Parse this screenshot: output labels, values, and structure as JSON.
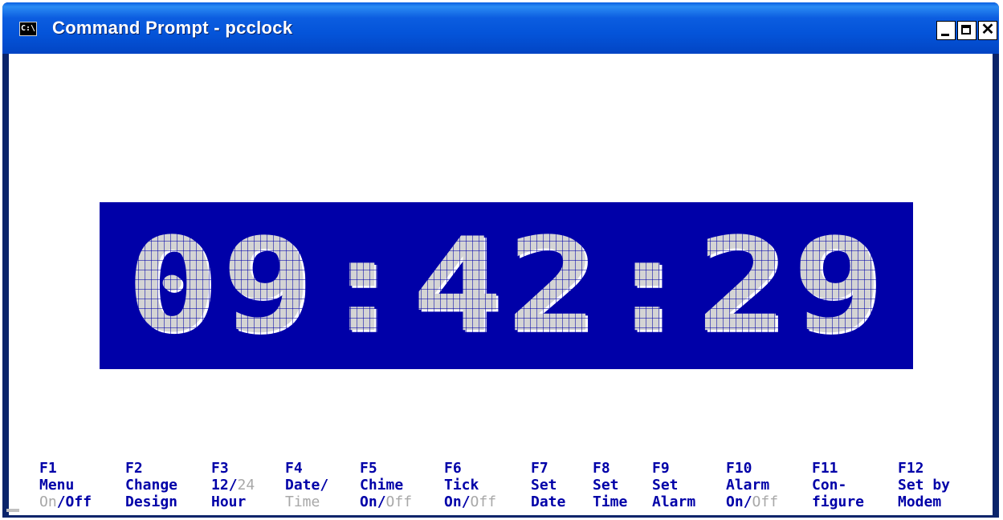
{
  "window": {
    "title": "Command Prompt - pcclock",
    "icon_text": "C:\\",
    "close_glyph": "✕"
  },
  "clock": {
    "time": "09:42:29",
    "digit_color": "#d4d4d4",
    "background_color": "#0000a8"
  },
  "fkeys": [
    {
      "key": "F1",
      "line2": "Menu",
      "line3_a": "On",
      "line3_sep": "/",
      "line3_b": "Off"
    },
    {
      "key": "F2",
      "line2": "Change",
      "line3_a": "",
      "line3_sep": "",
      "line3_b": "Design"
    },
    {
      "key": "F3",
      "line2_a": "12",
      "line2_sep": "/",
      "line2_b": "24",
      "line3": "Hour"
    },
    {
      "key": "F4",
      "line2": "Date/",
      "line3": "Time"
    },
    {
      "key": "F5",
      "line2": "Chime",
      "line3_a": "On",
      "line3_sep": "/",
      "line3_b": "Off"
    },
    {
      "key": "F6",
      "line2": "Tick",
      "line3_a": "On",
      "line3_sep": "/",
      "line3_b": "Off"
    },
    {
      "key": "F7",
      "line2": "Set",
      "line3": "Date"
    },
    {
      "key": "F8",
      "line2": "Set",
      "line3": "Time"
    },
    {
      "key": "F9",
      "line2": "Set",
      "line3": "Alarm"
    },
    {
      "key": "F10",
      "line2": "Alarm",
      "line3_a": "On",
      "line3_sep": "/",
      "line3_b": "Off"
    },
    {
      "key": "F11",
      "line2": "Con-",
      "line3": "figure"
    },
    {
      "key": "F12",
      "line2": "Set by",
      "line3": "Modem"
    }
  ],
  "colors": {
    "title_bar": "#0454d9",
    "fkey_text": "#0000a8",
    "fkey_inactive": "#a8a8a8"
  }
}
